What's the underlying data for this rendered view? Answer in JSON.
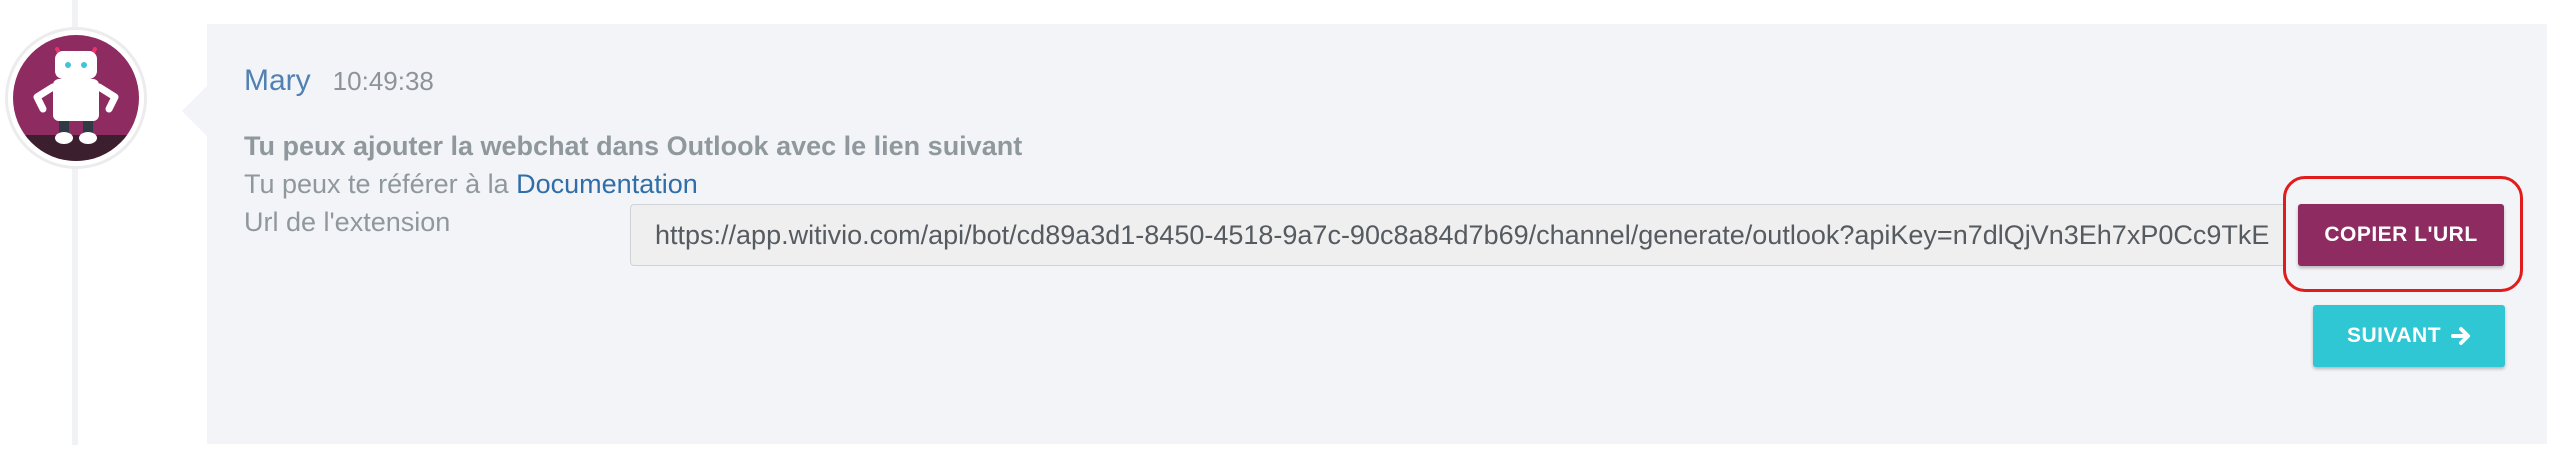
{
  "message": {
    "author": "Mary",
    "time": "10:49:38",
    "line1": "Tu peux ajouter la webchat dans Outlook avec le lien suivant",
    "line2_prefix": "Tu peux te référer à la ",
    "line2_link": "Documentation",
    "url_label": "Url de l'extension",
    "url_value": "https://app.witivio.com/api/bot/cd89a3d1-8450-4518-9a7c-90c8a84d7b69/channel/generate/outlook?apiKey=n7dlQjVn3Eh7xP0Cc9TkE"
  },
  "buttons": {
    "copy_label": "COPIER L'URL",
    "next_label": "SUIVANT"
  },
  "icons": {
    "avatar": "robot-avatar-icon",
    "next": "arrow-right-icon"
  },
  "colors": {
    "author": "#5080b4",
    "link": "#2f6ea8",
    "copy_button": "#8e2c61",
    "next_button": "#2ec7d3",
    "highlight": "#e01c1c",
    "bubble": "#f3f4f7"
  }
}
